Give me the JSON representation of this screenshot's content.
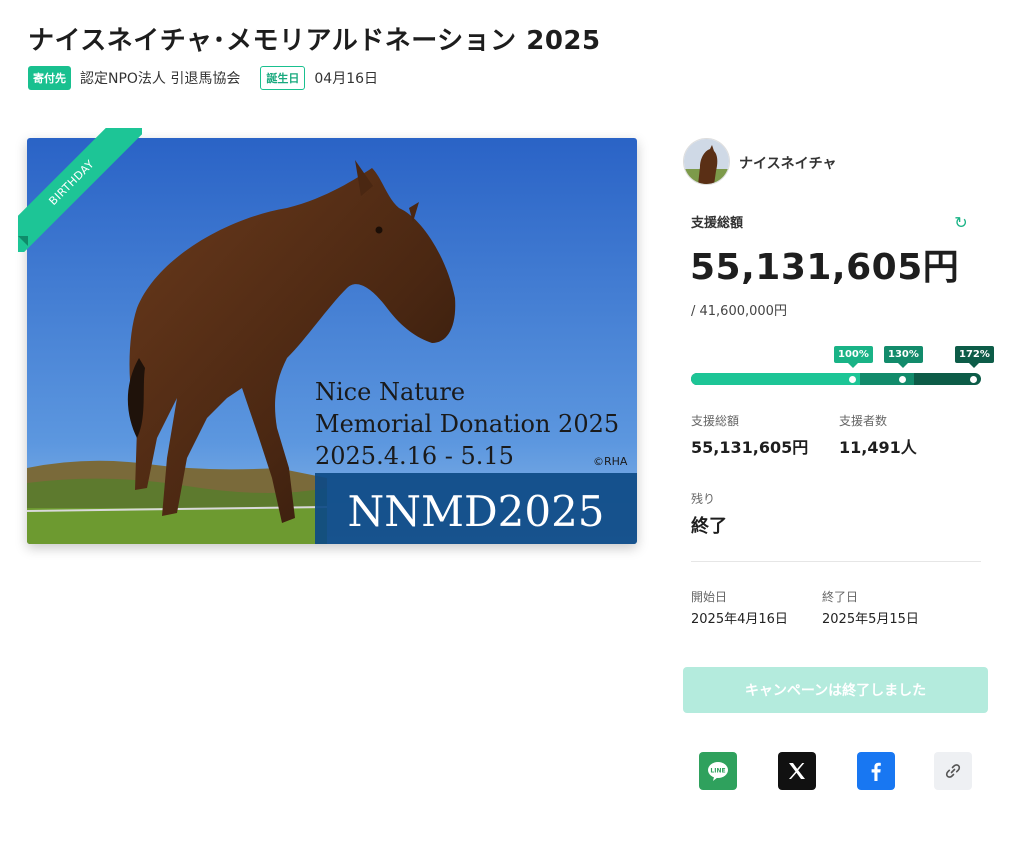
{
  "header": {
    "title": "ナイスネイチャ･メモリアルドネーション 2025",
    "beneficiary_tag": "寄付先",
    "beneficiary": "認定NPO法人 引退馬協会",
    "birthday_tag": "誕生日",
    "birthday": "04月16日"
  },
  "hero": {
    "ribbon": "BIRTHDAY",
    "line1": "Nice Nature",
    "line2": "Memorial Donation 2025",
    "line3": "2025.4.16 - 5.15",
    "credit": "©RHA",
    "banner": "NNMD2025"
  },
  "sidebar": {
    "name": "ナイスネイチャ",
    "total_label": "支援総額",
    "total_amount": "55,131,605円",
    "goal": "/ 41,600,000円",
    "milestones": [
      {
        "label": "100%",
        "value": 100
      },
      {
        "label": "130%",
        "value": 130
      },
      {
        "label": "172%",
        "value": 172
      }
    ],
    "progress_percent": 132,
    "stats": {
      "total_label": "支援総額",
      "total_value": "55,131,605円",
      "supporters_label": "支援者数",
      "supporters_value": "11,491人"
    },
    "remaining_label": "残り",
    "remaining_value": "終了",
    "start_label": "開始日",
    "start_value": "2025年4月16日",
    "end_label": "終了日",
    "end_value": "2025年5月15日",
    "cta": "キャンペーンは終了しました",
    "icons": {
      "refresh": "refresh-icon",
      "line": "line-icon",
      "x": "x-icon",
      "facebook": "facebook-icon",
      "link": "link-icon"
    }
  },
  "colors": {
    "accent": "#19c08f",
    "progress_light": "#1dc596",
    "progress_mid": "#128b6b",
    "progress_dark": "#0d5c48",
    "cta_disabled": "#b4ebdd"
  }
}
